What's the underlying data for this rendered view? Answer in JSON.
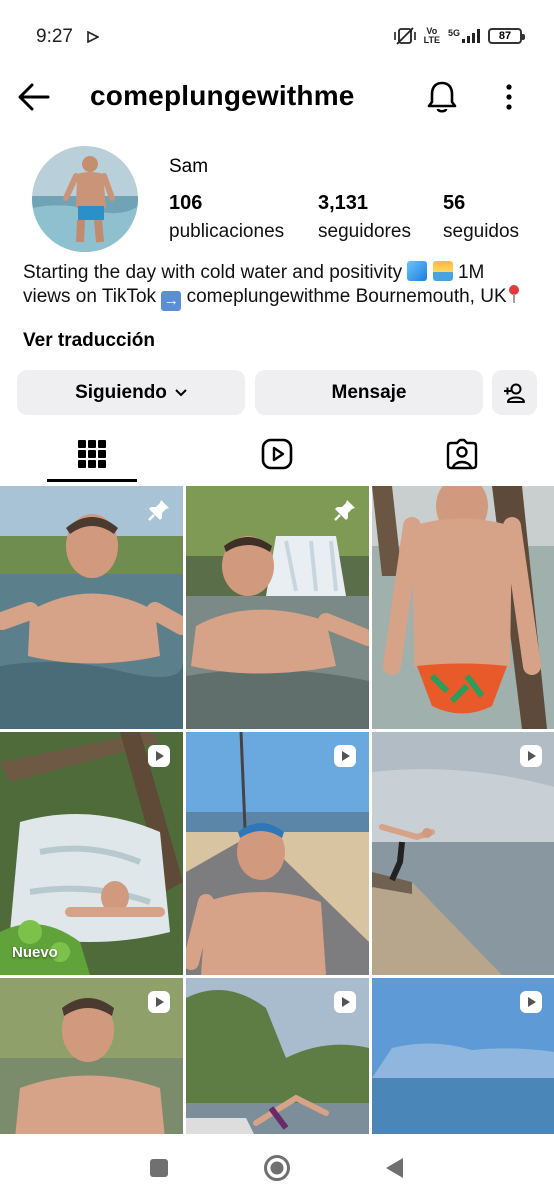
{
  "status_bar": {
    "time": "9:27",
    "network_top": "Vo",
    "network_bottom": "LTE",
    "signal_label": "5G",
    "battery": "87"
  },
  "header": {
    "username": "comeplungewithme"
  },
  "profile": {
    "name": "Sam",
    "stats": [
      {
        "value": "106",
        "label": "publicaciones"
      },
      {
        "value": "3,131",
        "label": "seguidores"
      },
      {
        "value": "56",
        "label": "seguidos"
      }
    ],
    "bio_part1": "Starting the day with cold water and positivity",
    "bio_part2": "1M views on TikTok",
    "bio_part3": "comeplungewithme Bournemouth, UK",
    "translate_link": "Ver traducción"
  },
  "actions": {
    "following_label": "Siguiendo",
    "message_label": "Mensaje"
  },
  "tabs": [
    {
      "icon": "grid-icon",
      "active": true
    },
    {
      "icon": "reels-icon",
      "active": false
    },
    {
      "icon": "tagged-icon",
      "active": false
    }
  ],
  "posts": [
    {
      "badge": "pin-icon"
    },
    {
      "badge": "pin-icon"
    },
    {
      "badge": ""
    },
    {
      "badge": "reel-icon",
      "label": "Nuevo"
    },
    {
      "badge": "reel-icon"
    },
    {
      "badge": "reel-icon"
    },
    {
      "badge": "reel-icon"
    },
    {
      "badge": "reel-icon"
    },
    {
      "badge": "reel-icon"
    }
  ],
  "colors": {
    "button_bg": "#efeff2",
    "text": "#000000"
  }
}
